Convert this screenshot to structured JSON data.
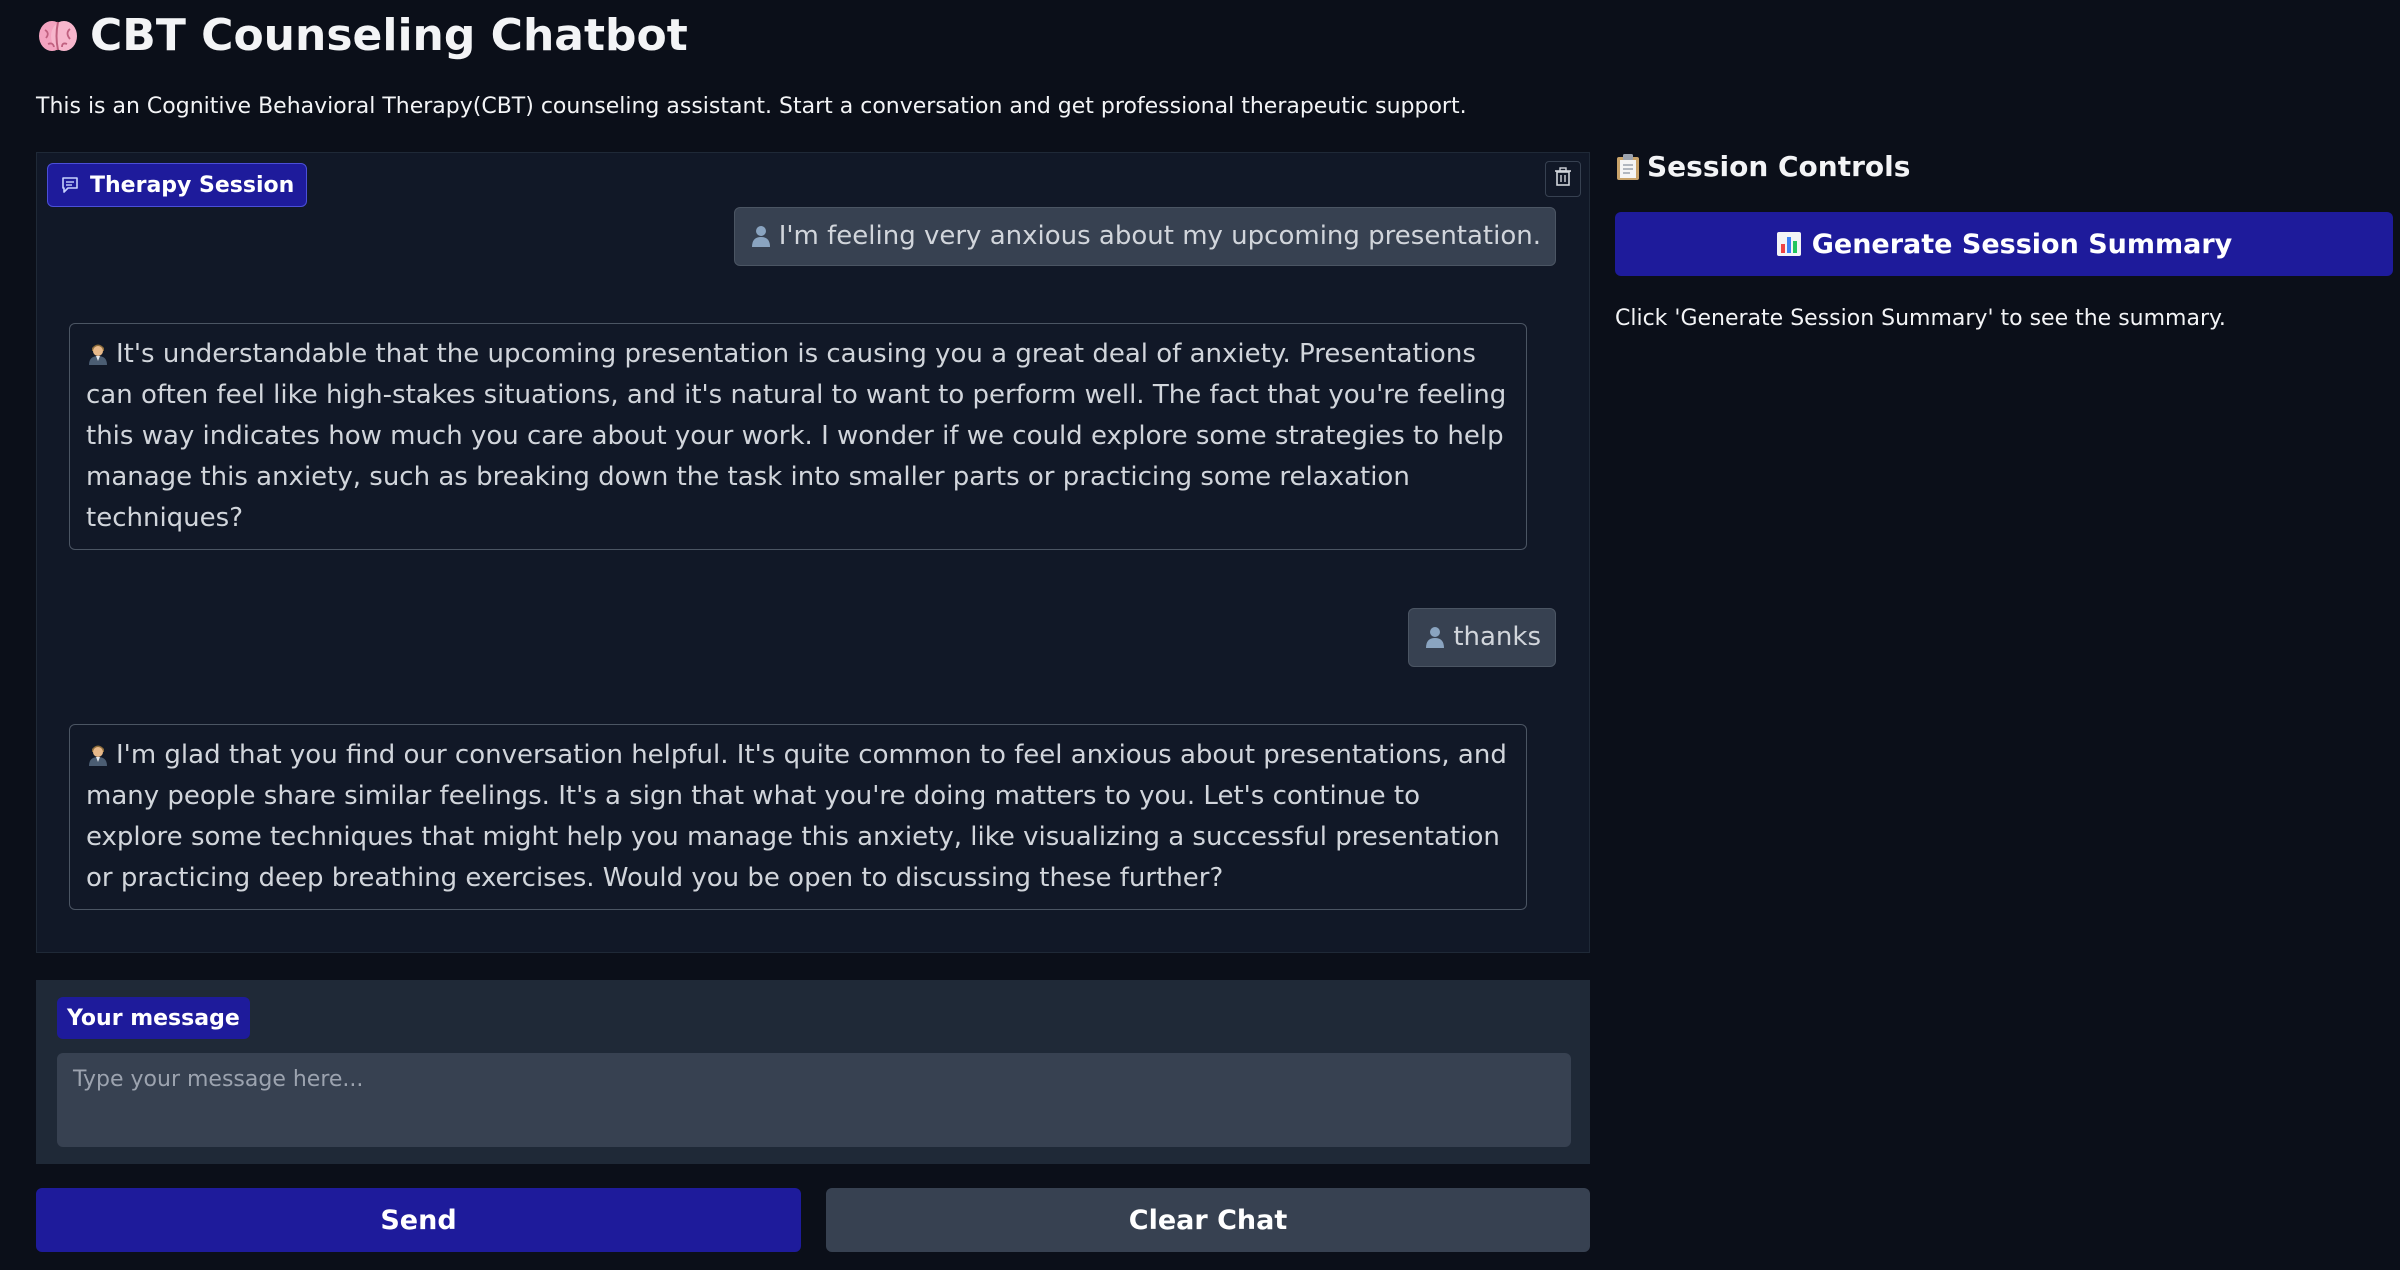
{
  "header": {
    "title": "CBT Counseling Chatbot",
    "title_icon": "brain-icon",
    "description": "This is an Cognitive Behavioral Therapy(CBT) counseling assistant. Start a conversation and get professional therapeutic support."
  },
  "chat": {
    "label": "Therapy Session",
    "label_icon": "chat-icon",
    "clear_icon": "trash-icon",
    "messages": [
      {
        "role": "user",
        "avatar": "user-icon",
        "text": "I'm feeling very anxious about my upcoming presentation."
      },
      {
        "role": "assistant",
        "avatar": "therapist-icon",
        "text": "It's understandable that the upcoming presentation is causing you a great deal of anxiety. Presentations can often feel like high-stakes situations, and it's natural to want to perform well. The fact that you're feeling this way indicates how much you care about your work. I wonder if we could explore some strategies to help manage this anxiety, such as breaking down the task into smaller parts or practicing some relaxation techniques?"
      },
      {
        "role": "user",
        "avatar": "user-icon",
        "text": "thanks"
      },
      {
        "role": "assistant",
        "avatar": "therapist-icon",
        "text": "I'm glad that you find our conversation helpful. It's quite common to feel anxious about presentations, and many people share similar feelings. It's a sign that what you're doing matters to you. Let's continue to explore some techniques that might help you manage this anxiety, like visualizing a successful presentation or practicing deep breathing exercises. Would you be open to discussing these further?"
      }
    ]
  },
  "input": {
    "label": "Your message",
    "placeholder": "Type your message here...",
    "value": ""
  },
  "buttons": {
    "send": "Send",
    "clear": "Clear Chat"
  },
  "controls": {
    "title": "Session Controls",
    "title_icon": "clipboard-icon",
    "summary_button": "Generate Session Summary",
    "summary_button_icon": "bar-chart-icon",
    "summary_text": "Click 'Generate Session Summary' to see the summary."
  },
  "colors": {
    "background": "#0b0f19",
    "panel": "#111827",
    "accent": "#1e1b9b",
    "secondary_button": "#374151"
  }
}
